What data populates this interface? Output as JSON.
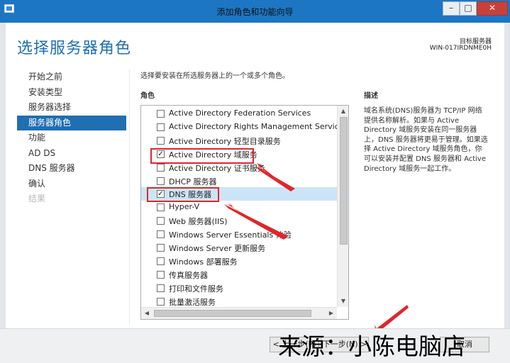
{
  "window": {
    "title": "添加角色和功能向导",
    "min_label": "–",
    "max_label": "□",
    "close_label": "✕"
  },
  "header": {
    "heading": "选择服务器角色",
    "destination_label": "目标服务器",
    "destination_value": "WIN-017IRDNME0H"
  },
  "nav": {
    "items": [
      {
        "label": "开始之前",
        "state": "normal"
      },
      {
        "label": "安装类型",
        "state": "normal"
      },
      {
        "label": "服务器选择",
        "state": "normal"
      },
      {
        "label": "服务器角色",
        "state": "active"
      },
      {
        "label": "功能",
        "state": "normal"
      },
      {
        "label": "AD DS",
        "state": "normal"
      },
      {
        "label": "DNS 服务器",
        "state": "normal"
      },
      {
        "label": "确认",
        "state": "normal"
      },
      {
        "label": "结果",
        "state": "disabled"
      }
    ]
  },
  "main": {
    "intro": "选择要安装在所选服务器上的一个或多个角色。",
    "roles_header": "角色",
    "description_header": "描述",
    "description": "域名系统(DNS)服务器为 TCP/IP 网络提供名称解析。如果与 Active Directory 域服务安装在同一服务器上，DNS 服务器将更易于管理。如果选择 Active Directory 域服务角色，你可以安装并配置 DNS 服务器和 Active Directory 域服务一起工作。",
    "roles": [
      {
        "label": "Active Directory Federation Services",
        "checked": false,
        "selected": false
      },
      {
        "label": "Active Directory Rights Management Services",
        "checked": false,
        "selected": false
      },
      {
        "label": "Active Directory 轻型目录服务",
        "checked": false,
        "selected": false
      },
      {
        "label": "Active Directory 域服务",
        "checked": true,
        "selected": false
      },
      {
        "label": "Active Directory 证书服务",
        "checked": false,
        "selected": false
      },
      {
        "label": "DHCP 服务器",
        "checked": false,
        "selected": false
      },
      {
        "label": "DNS 服务器",
        "checked": true,
        "selected": true
      },
      {
        "label": "Hyper-V",
        "checked": false,
        "selected": false
      },
      {
        "label": "Web 服务器(IIS)",
        "checked": false,
        "selected": false
      },
      {
        "label": "Windows Server Essentials 体验",
        "checked": false,
        "selected": false
      },
      {
        "label": "Windows Server 更新服务",
        "checked": false,
        "selected": false
      },
      {
        "label": "Windows 部署服务",
        "checked": false,
        "selected": false
      },
      {
        "label": "传真服务器",
        "checked": false,
        "selected": false
      },
      {
        "label": "打印和文件服务",
        "checked": false,
        "selected": false
      },
      {
        "label": "批量激活服务",
        "checked": false,
        "selected": false
      }
    ]
  },
  "footer": {
    "prev_label": "< 上一步(P)",
    "next_label": "下一步(N) >",
    "cancel_label": "取消",
    "watermark": "来源：小陈电脑店"
  },
  "colors": {
    "accent": "#1f6fb2",
    "annotation_red": "#e0262b",
    "selection": "#cce4f7"
  }
}
